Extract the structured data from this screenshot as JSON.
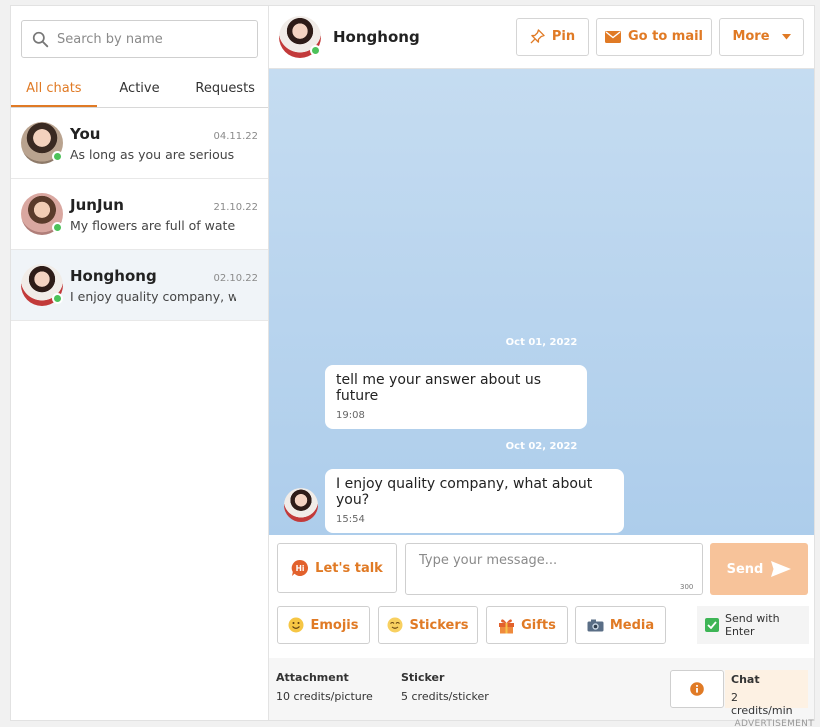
{
  "search": {
    "placeholder": "Search by name"
  },
  "tabs": [
    {
      "label": "All chats",
      "active": true
    },
    {
      "label": "Active",
      "active": false
    },
    {
      "label": "Requests",
      "active": false
    }
  ],
  "conversations": [
    {
      "name": "You",
      "date": "04.11.22",
      "preview": "As long as you are serious to",
      "online": true
    },
    {
      "name": "JunJun",
      "date": "21.10.22",
      "preview": "My flowers are full of water, c",
      "online": true
    },
    {
      "name": "Honghong",
      "date": "02.10.22",
      "preview": "I enjoy quality company, wha",
      "online": true,
      "selected": true
    }
  ],
  "header": {
    "name": "Honghong",
    "pin_label": "Pin",
    "mail_label": "Go to mail",
    "more_label": "More"
  },
  "messages": [
    {
      "date": "Oct 01, 2022",
      "text": "tell me your answer about us future",
      "time": "19:08",
      "with_avatar": false
    },
    {
      "date": "Oct 02, 2022",
      "text": "I enjoy quality company, what about you?",
      "time": "15:54",
      "with_avatar": true
    }
  ],
  "composer": {
    "talk_label": "Let's talk",
    "placeholder": "Type your message...",
    "char_count": "300",
    "send_label": "Send",
    "emojis_label": "Emojis",
    "stickers_label": "Stickers",
    "gifts_label": "Gifts",
    "media_label": "Media",
    "send_with_enter_label": "Send with Enter",
    "send_with_enter_checked": true
  },
  "credits": {
    "attachment_title": "Attachment",
    "attachment_value": "10 credits/picture",
    "sticker_title": "Sticker",
    "sticker_value": "5 credits/sticker",
    "chat_title": "Chat",
    "chat_value": "2 credits/min"
  },
  "advertisement_label": "ADVERTISEMENT",
  "colors": {
    "accent": "#e07a25",
    "online": "#4cc25a",
    "send_disabled": "#f7c39a",
    "chat_bg_top": "#c5dcf1",
    "chat_bg_bottom": "#adcdeb"
  }
}
